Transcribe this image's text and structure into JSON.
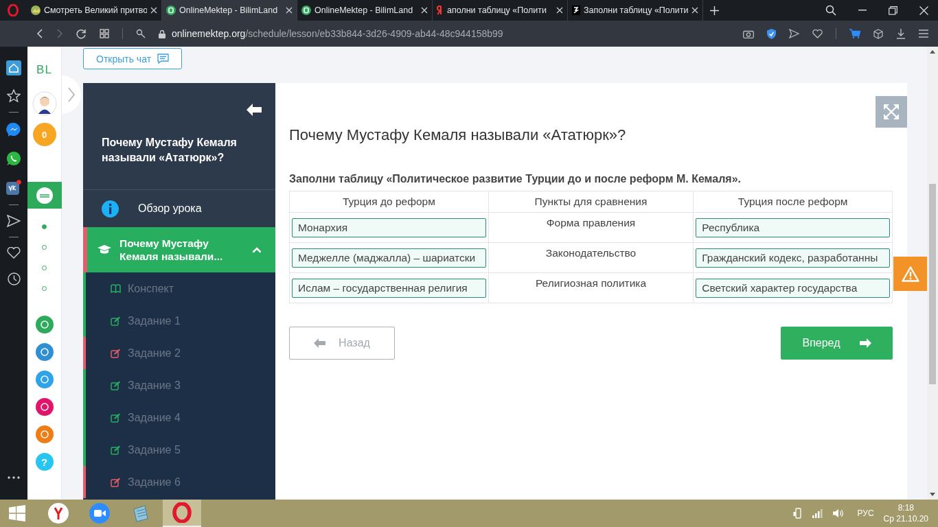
{
  "browser": {
    "tabs": [
      {
        "title": "Смотреть Великий притво",
        "kind": "picture",
        "selected": false
      },
      {
        "title": "OnlineMektep - BilimLand",
        "kind": "bilimland",
        "selected": true
      },
      {
        "title": "OnlineMektep - BilimLand",
        "kind": "bilimland",
        "selected": false
      },
      {
        "title": "аполни таблицу «Полити",
        "kind": "yandex",
        "selected": false
      },
      {
        "title": "Заполни таблицу «Полити",
        "kind": "zen",
        "selected": false
      }
    ],
    "address": {
      "domain": "onlinemektep.org",
      "path": "/schedule/lesson/eb33b844-3d26-4909-ab44-48c944158b99"
    }
  },
  "site_sidebar": {
    "logo": "BL",
    "coins": "0",
    "steps": [
      {
        "selected": true
      },
      {
        "selected": false
      },
      {
        "selected": false
      },
      {
        "selected": false
      }
    ],
    "apps": [
      {
        "color": "#2eaa5c"
      },
      {
        "color": "#2f8fd0"
      },
      {
        "color": "#2ea3e8"
      },
      {
        "color": "#e0166a"
      },
      {
        "color": "#ee7d16"
      }
    ],
    "help": "?"
  },
  "chat_button": "Открыть чат",
  "lesson_nav": {
    "title": "Почему Мустафу Кемаля называли «Ататюрк»?",
    "overview": "Обзор урока",
    "section": {
      "title": "Почему Мустафу Кемаля называли...",
      "expanded": true,
      "items": [
        {
          "label": "Конспект",
          "kind": "notes",
          "color": "#27ae60"
        },
        {
          "label": "Задание 1",
          "kind": "task",
          "color": "#27ae60"
        },
        {
          "label": "Задание 2",
          "kind": "task",
          "color": "#e35d6a"
        },
        {
          "label": "Задание 3",
          "kind": "task",
          "color": "#27ae60"
        },
        {
          "label": "Задание 4",
          "kind": "task",
          "color": "#27ae60"
        },
        {
          "label": "Задание 5",
          "kind": "task",
          "color": "#27ae60"
        },
        {
          "label": "Задание 6",
          "kind": "task",
          "color": "#e35d6a"
        }
      ]
    }
  },
  "lesson": {
    "heading": "Почему Мустафу Кемаля называли «Ататюрк»?",
    "task": "Заполни таблицу «Политическое развитие Турции до и после реформ М. Кемаля».",
    "table": {
      "columns": [
        "Турция до реформ",
        "Пункты для сравнения",
        "Турция после реформ"
      ],
      "rows": [
        {
          "before": "Монархия",
          "criterion": "Форма правления",
          "after": "Республика"
        },
        {
          "before": "Меджелле (маджалла) – шариатски",
          "criterion": "Законодательство",
          "after": "Гражданский кодекс, разработанны"
        },
        {
          "before": "Ислам – государственная религия",
          "criterion": "Религиозная политика",
          "after": "Светский характер государства"
        }
      ]
    },
    "back_button": {
      "label": "Назад",
      "disabled": true
    },
    "next_button": {
      "label": "Вперед",
      "disabled": false
    }
  },
  "taskbar": {
    "apps": [
      {
        "kind": "yandex",
        "selected": false
      },
      {
        "kind": "zoom",
        "selected": false
      },
      {
        "kind": "notepad",
        "selected": false
      },
      {
        "kind": "opera",
        "selected": true
      }
    ],
    "language": "РУС",
    "time": "8:18",
    "date": "Ср 21.10.20"
  }
}
